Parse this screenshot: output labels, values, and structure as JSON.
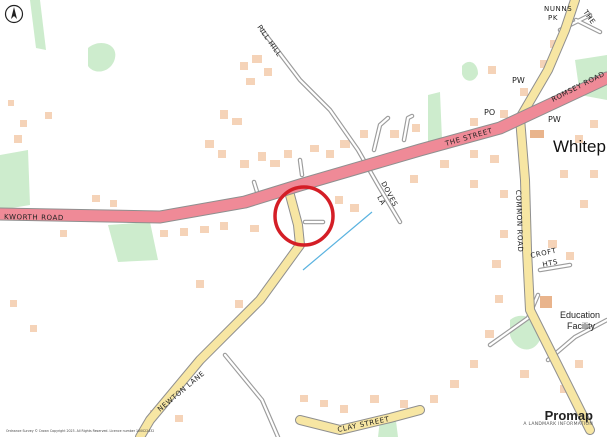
{
  "labels": {
    "town": "Whitep",
    "roads": {
      "kworth": "KWORTH ROAD",
      "the_street": "THE STREET",
      "romsey": "ROMSEY ROAD",
      "pill_hill": "PILL HILL",
      "doves": "DOVES",
      "la": "LA",
      "common": "COMMON ROAD",
      "newton": "NEWTON LANE",
      "clay": "CLAY STREET",
      "croft": "CROFT",
      "hts": "HTS",
      "the": "THE",
      "nunns": "NUNNS",
      "pk": "PK"
    },
    "pois": {
      "pw1": "PW",
      "pw2": "PW",
      "po": "PO",
      "education_1": "Education",
      "education_2": "Facility"
    },
    "copyright": "Ordnance Survey © Crown Copyright 2023. All Rights Reserved. Licence number 100022432",
    "brand_name": "Promap",
    "brand_tagline": "A LANDMARK INFORMATION"
  },
  "colors": {
    "main_road": "#ef8a97",
    "minor_road": "#f7e6a3",
    "lane": "#c8c8c8",
    "green": "#cdeccd",
    "building": "#f5d3b8",
    "stream": "#5ab3e0",
    "marker": "#d41e26"
  },
  "icons": {
    "north": "north-arrow-icon",
    "marker": "site-marker-circle-icon"
  }
}
